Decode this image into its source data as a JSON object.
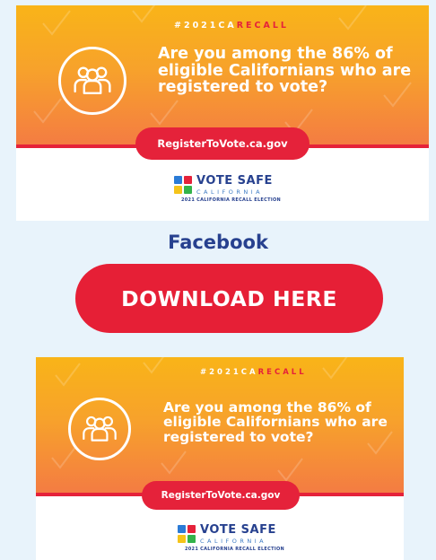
{
  "graphic": {
    "hashtag_prefix": "#2021CA",
    "hashtag_suffix": "RECALL",
    "headline": "Are you among the 86% of eligible Californians who are registered to vote?",
    "url": "RegisterToVote.ca.gov",
    "icon": "people-group-icon",
    "logo": {
      "title": "VOTE SAFE",
      "state": "CALIFORNIA",
      "subtitle": "2021 CALIFORNIA RECALL ELECTION",
      "grid_colors": [
        "#2b7bd6",
        "#e5223a",
        "#f5c41a",
        "#33b34a"
      ]
    }
  },
  "section": {
    "label": "Facebook"
  },
  "download_button": {
    "label": "DOWNLOAD HERE"
  },
  "colors": {
    "background": "#e8f3fb",
    "accent_red": "#e5223a",
    "navy": "#27418f",
    "banner_top": "#f9b418",
    "banner_bottom": "#f47b43"
  }
}
